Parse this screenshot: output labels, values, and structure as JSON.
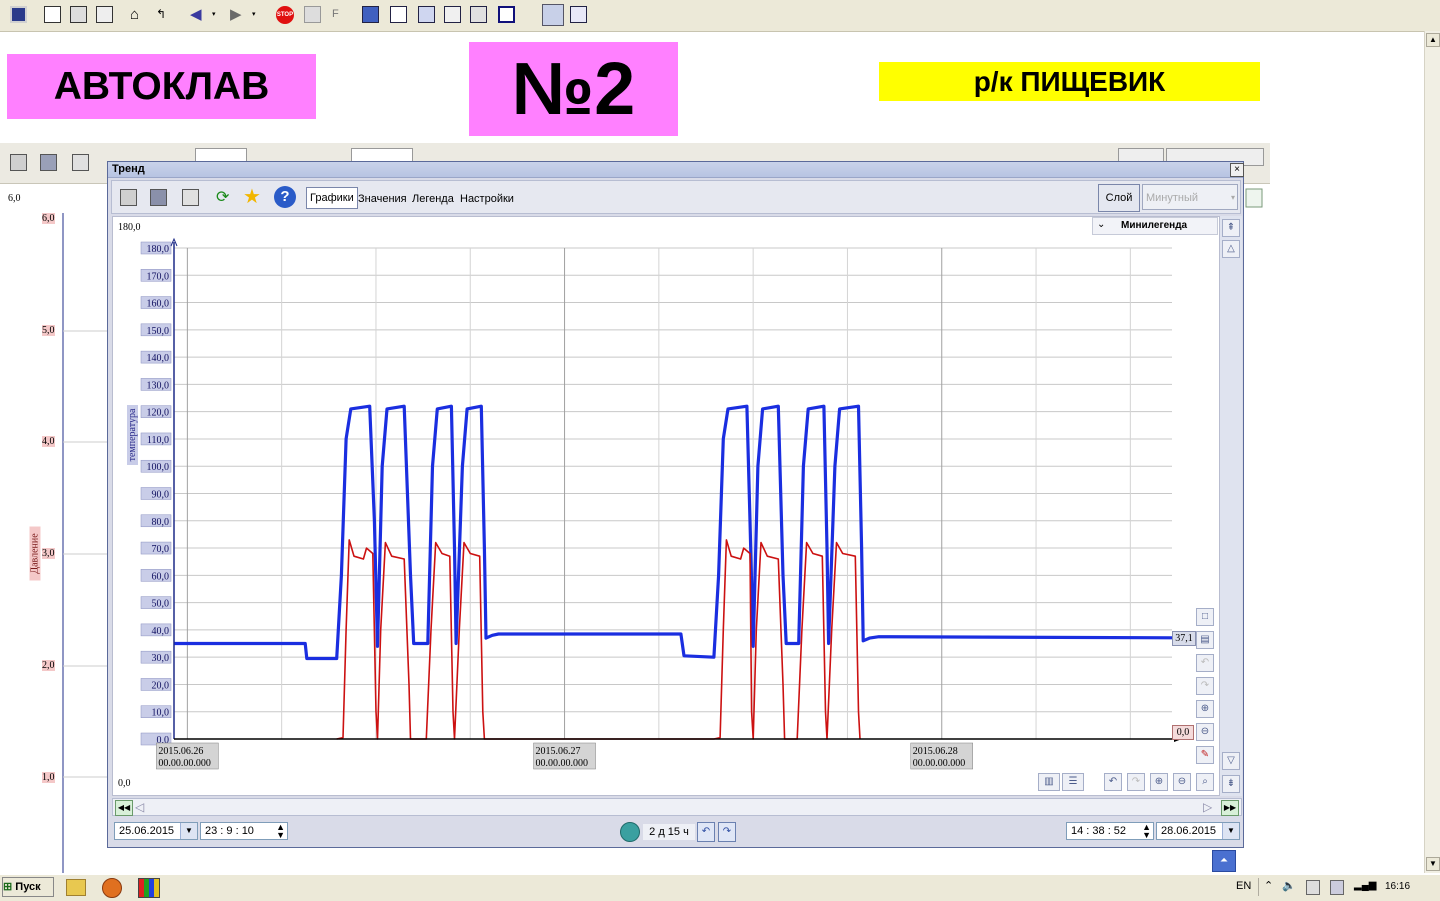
{
  "header": {
    "autoclave_label": "АВТОКЛАВ",
    "number_label": "№2",
    "product_label": "р/к ПИЩЕВИК"
  },
  "colors": {
    "label_magenta": "#ff80ff",
    "label_yellow": "#ffff00",
    "temp_series": "#1a2ee0",
    "pressure_series": "#cc1111"
  },
  "trend_window": {
    "title": "Тренд",
    "close": "×",
    "tabs": [
      "Графики",
      "Значения",
      "Легенда",
      "Настройки"
    ],
    "layer_button": "Слой",
    "layer_select": "Минутный",
    "minilegend": "Минилегенда",
    "range_top": "180,0",
    "range_bottom": "0,0",
    "current_temp_value": "37,1",
    "current_pressure_value": "0,0",
    "start_date": "25.06.2015",
    "start_time": "23 : 9 : 10",
    "duration": "2 д 15 ч",
    "end_time": "14 : 38 : 52",
    "end_date": "28.06.2015"
  },
  "background_trend": {
    "range_top": "6,0",
    "axis_label": "Давление",
    "ticks": [
      "6,0",
      "5,0",
      "4,0",
      "3,0",
      "2,0",
      "1,0"
    ]
  },
  "taskbar": {
    "start": "Пуск",
    "lang": "EN",
    "clock": "16:16"
  },
  "chart_data": {
    "type": "line",
    "ylabel": "температура",
    "ylim": [
      0,
      180
    ],
    "yticks": [
      "0,0",
      "10,0",
      "20,0",
      "30,0",
      "40,0",
      "50,0",
      "60,0",
      "70,0",
      "80,0",
      "90,0",
      "100,0",
      "110,0",
      "120,0",
      "130,0",
      "140,0",
      "150,0",
      "160,0",
      "170,0",
      "180,0"
    ],
    "x_ticks": [
      {
        "date": "2015.06.26",
        "time": "00.00.00.000",
        "hours": 0
      },
      {
        "date": "2015.06.27",
        "time": "00.00.00.000",
        "hours": 24
      },
      {
        "date": "2015.06.28",
        "time": "00.00.00.000",
        "hours": 48
      }
    ],
    "xlim_hours": [
      -0.85,
      62.65
    ],
    "series": [
      {
        "color": "#1a2ee0",
        "points": [
          [
            -0.85,
            35
          ],
          [
            7.5,
            35
          ],
          [
            7.6,
            29.5
          ],
          [
            9.5,
            29.5
          ],
          [
            9.8,
            60
          ],
          [
            10.1,
            110
          ],
          [
            10.4,
            121
          ],
          [
            11.6,
            122
          ],
          [
            11.9,
            80
          ],
          [
            12.1,
            34
          ],
          [
            12.4,
            100
          ],
          [
            12.7,
            121
          ],
          [
            13.8,
            122
          ],
          [
            14.2,
            60
          ],
          [
            14.4,
            35
          ],
          [
            15.3,
            35
          ],
          [
            15.6,
            100
          ],
          [
            15.9,
            121
          ],
          [
            16.8,
            122
          ],
          [
            17.0,
            70
          ],
          [
            17.1,
            35
          ],
          [
            17.5,
            100
          ],
          [
            17.8,
            121
          ],
          [
            18.7,
            122
          ],
          [
            18.9,
            70
          ],
          [
            19.0,
            37
          ],
          [
            19.4,
            38
          ],
          [
            19.8,
            38.5
          ],
          [
            31.4,
            38.5
          ],
          [
            31.6,
            30.5
          ],
          [
            33.5,
            30
          ],
          [
            33.8,
            60
          ],
          [
            34.1,
            110
          ],
          [
            34.4,
            121
          ],
          [
            35.6,
            122
          ],
          [
            35.8,
            80
          ],
          [
            36.0,
            34
          ],
          [
            36.3,
            100
          ],
          [
            36.6,
            121
          ],
          [
            37.6,
            122
          ],
          [
            37.9,
            60
          ],
          [
            38.1,
            35
          ],
          [
            38.9,
            35
          ],
          [
            39.2,
            100
          ],
          [
            39.5,
            121
          ],
          [
            40.5,
            122
          ],
          [
            40.7,
            70
          ],
          [
            40.8,
            35
          ],
          [
            41.2,
            100
          ],
          [
            41.5,
            121
          ],
          [
            42.7,
            122
          ],
          [
            42.9,
            70
          ],
          [
            43.0,
            36
          ],
          [
            43.4,
            37
          ],
          [
            44.0,
            37.5
          ],
          [
            62.65,
            37.1
          ]
        ]
      },
      {
        "color": "#cc1111",
        "points": [
          [
            9.5,
            0
          ],
          [
            9.9,
            0.5
          ],
          [
            10.1,
            40
          ],
          [
            10.3,
            73
          ],
          [
            10.6,
            67
          ],
          [
            11.2,
            66
          ],
          [
            11.4,
            70
          ],
          [
            11.8,
            68
          ],
          [
            12.0,
            10
          ],
          [
            12.1,
            0
          ],
          [
            12.3,
            40
          ],
          [
            12.6,
            72
          ],
          [
            13.0,
            67
          ],
          [
            13.8,
            66
          ],
          [
            14.1,
            20
          ],
          [
            14.2,
            0
          ],
          [
            15.2,
            0
          ],
          [
            15.5,
            40
          ],
          [
            15.8,
            72
          ],
          [
            16.2,
            68
          ],
          [
            16.7,
            67
          ],
          [
            16.9,
            10
          ],
          [
            17.0,
            0
          ],
          [
            17.3,
            40
          ],
          [
            17.6,
            72
          ],
          [
            18.0,
            68
          ],
          [
            18.6,
            67
          ],
          [
            18.8,
            10
          ],
          [
            18.9,
            0
          ],
          [
            33.5,
            0
          ],
          [
            33.9,
            0.5
          ],
          [
            34.1,
            40
          ],
          [
            34.3,
            73
          ],
          [
            34.6,
            67
          ],
          [
            35.2,
            66
          ],
          [
            35.4,
            70
          ],
          [
            35.8,
            68
          ],
          [
            35.9,
            10
          ],
          [
            36.0,
            0
          ],
          [
            36.2,
            40
          ],
          [
            36.5,
            72
          ],
          [
            36.9,
            67
          ],
          [
            37.6,
            66
          ],
          [
            37.9,
            20
          ],
          [
            38.0,
            0
          ],
          [
            38.8,
            0
          ],
          [
            39.1,
            40
          ],
          [
            39.4,
            72
          ],
          [
            39.8,
            68
          ],
          [
            40.4,
            67
          ],
          [
            40.6,
            10
          ],
          [
            40.7,
            0
          ],
          [
            41.0,
            40
          ],
          [
            41.3,
            72
          ],
          [
            41.7,
            68
          ],
          [
            42.5,
            67
          ],
          [
            42.7,
            10
          ],
          [
            42.8,
            0
          ]
        ]
      }
    ]
  }
}
